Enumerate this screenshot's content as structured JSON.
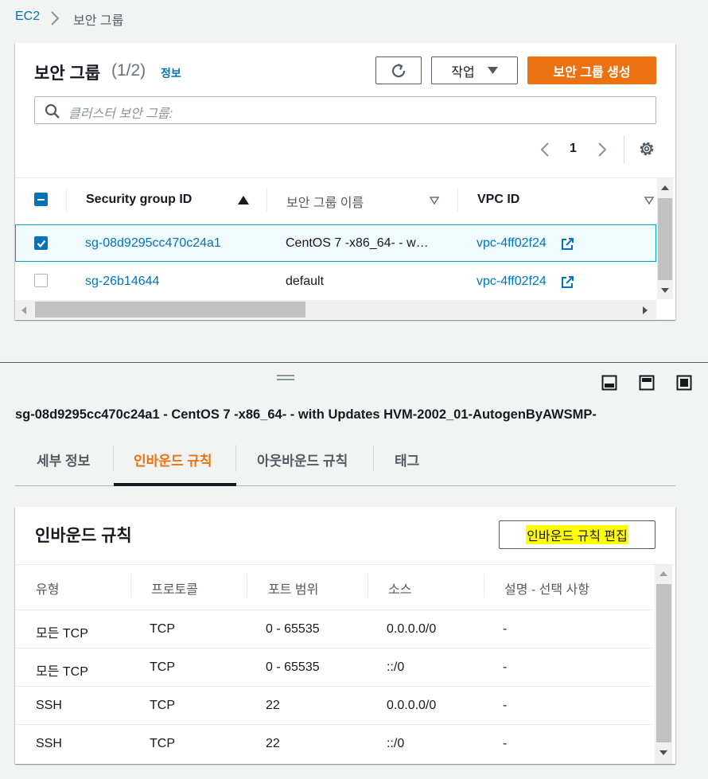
{
  "breadcrumb": {
    "root": "EC2",
    "current": "보안 그룹"
  },
  "top_panel": {
    "title": "보안 그룹",
    "count": "(1/2)",
    "info_link": "정보",
    "refresh_icon": "refresh-icon",
    "actions_label": "작업",
    "create_label": "보안 그룹 생성",
    "search_placeholder": "클러스터 보안 그룹:",
    "page_number": "1",
    "columns": [
      "Security group ID",
      "보안 그룹 이름",
      "VPC ID"
    ],
    "rows": [
      {
        "selected": true,
        "id": "sg-08d9295cc470c24a1",
        "name": "CentOS 7 -x86_64- - w…",
        "vpc": "vpc-4ff02f24"
      },
      {
        "selected": false,
        "id": "sg-26b14644",
        "name": "default",
        "vpc": "vpc-4ff02f24"
      }
    ]
  },
  "detail": {
    "title": "sg-08d9295cc470c24a1 - CentOS 7 -x86_64- - with Updates HVM-2002_01-AutogenByAWSMP-",
    "tabs": [
      "세부 정보",
      "인바운드 규칙",
      "아웃바운드 규칙",
      "태그"
    ],
    "active_tab": "인바운드 규칙"
  },
  "inbound": {
    "title": "인바운드 규칙",
    "edit_label": "인바운드 규칙 편집",
    "columns": [
      "유형",
      "프로토콜",
      "포트 범위",
      "소스",
      "설명 - 선택 사항"
    ],
    "rows": [
      [
        "모든 TCP",
        "TCP",
        "0 - 65535",
        "0.0.0.0/0",
        "-"
      ],
      [
        "모든 TCP",
        "TCP",
        "0 - 65535",
        "::/0",
        "-"
      ],
      [
        "SSH",
        "TCP",
        "22",
        "0.0.0.0/0",
        "-"
      ],
      [
        "SSH",
        "TCP",
        "22",
        "::/0",
        "-"
      ]
    ]
  },
  "colors": {
    "accent": "#0073bb",
    "primary": "#ec7211",
    "active_tab": "#ec7211",
    "highlight": "#ffff00"
  }
}
